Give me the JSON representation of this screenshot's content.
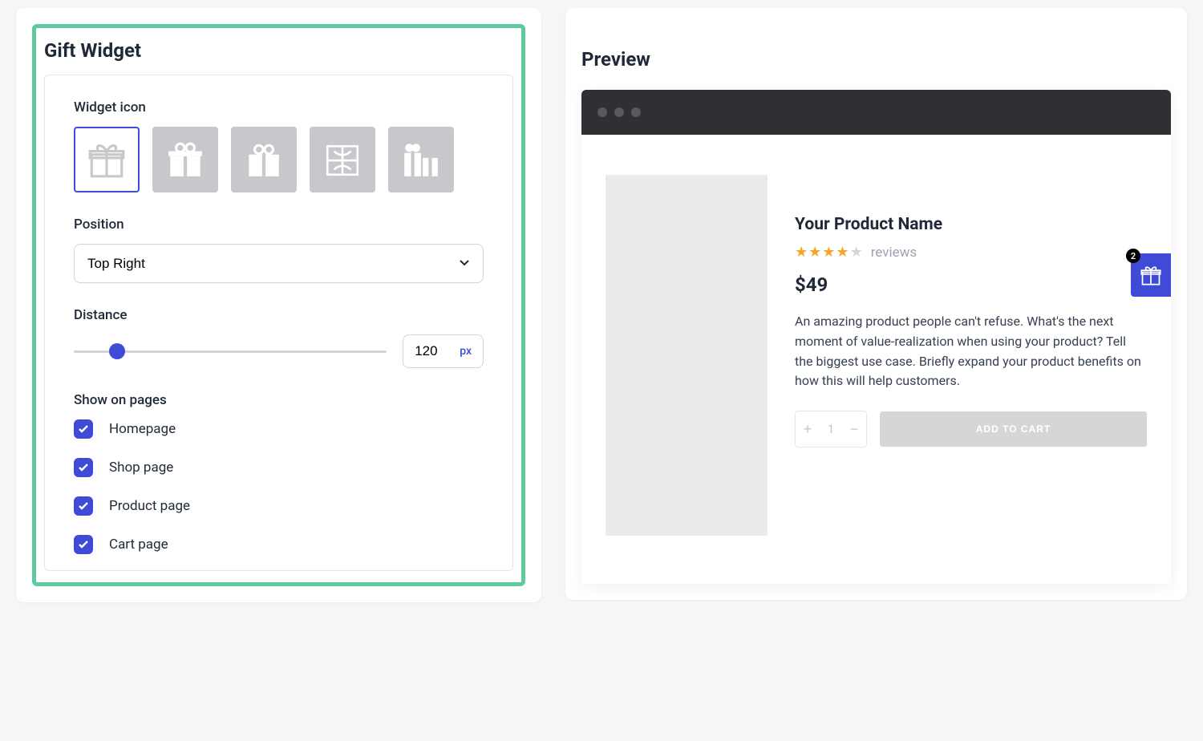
{
  "settings": {
    "title": "Gift Widget",
    "icon_label": "Widget icon",
    "icons": [
      "gift-outline",
      "gift-split",
      "gift-box",
      "gift-ribbon",
      "gift-multi"
    ],
    "selected_icon": 0,
    "position_label": "Position",
    "position_value": "Top Right",
    "distance_label": "Distance",
    "distance_value": "120",
    "distance_unit": "px",
    "show_label": "Show on pages",
    "pages": [
      {
        "label": "Homepage",
        "checked": true
      },
      {
        "label": "Shop page",
        "checked": true
      },
      {
        "label": "Product page",
        "checked": true
      },
      {
        "label": "Cart page",
        "checked": true
      }
    ]
  },
  "preview": {
    "title": "Preview",
    "product": {
      "name": "Your Product Name",
      "reviews_label": "reviews",
      "rating": 4,
      "price": "$49",
      "description": "An amazing product people can't refuse. What's the next moment of value-realization when using your product? Tell the biggest use case. Briefly expand your product benefits on how this will help customers.",
      "qty": "1",
      "add_to_cart": "ADD TO CART"
    },
    "widget_badge": "2"
  }
}
